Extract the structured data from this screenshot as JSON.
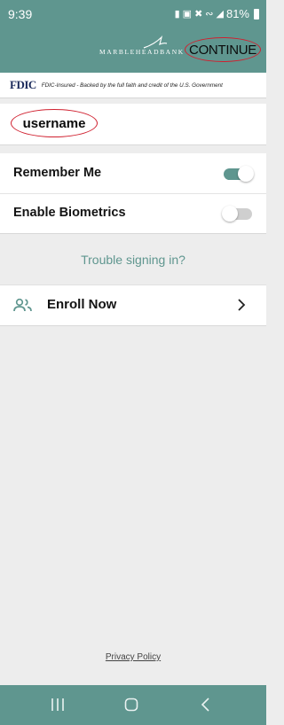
{
  "status_bar": {
    "time": "9:39",
    "battery": "81%"
  },
  "header": {
    "logo_text": "MARBLEHEADBANK",
    "continue_label": "CONTINUE"
  },
  "fdic": {
    "logo": "FDIC",
    "text": "FDIC-Insured - Backed by the full faith and credit of the U.S. Government"
  },
  "login": {
    "username_value": "username"
  },
  "settings": [
    {
      "label": "Remember Me",
      "enabled": true
    },
    {
      "label": "Enable Biometrics",
      "enabled": false
    }
  ],
  "trouble_link": "Trouble signing in?",
  "enroll": {
    "icon": "people-icon",
    "label": "Enroll Now",
    "chevron": "chevron-right-icon"
  },
  "privacy_link": "Privacy Policy",
  "nav": [
    "recents-icon",
    "home-icon",
    "back-icon"
  ],
  "colors": {
    "brand_teal": "#5f968f",
    "highlight_red": "#d0202f",
    "fdic_navy": "#1b2a5b",
    "background": "#ededed"
  }
}
